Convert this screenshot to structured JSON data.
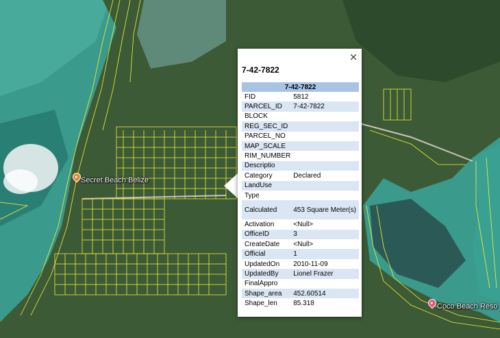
{
  "map": {
    "places": [
      {
        "label": "Secret Beach Belize",
        "pin_color": "#e8843a",
        "icon": "map-pin-icon"
      },
      {
        "label": "Coco Beach Reso",
        "pin_color": "#e05a7a",
        "icon": "map-pin-icon"
      }
    ]
  },
  "popup": {
    "title": "7-42-7822",
    "close_icon": "×",
    "table_header": "7-42-7822",
    "rows": [
      {
        "key": "FID",
        "value": "5812"
      },
      {
        "key": "PARCEL_ID",
        "value": "7-42-7822"
      },
      {
        "key": "BLOCK",
        "value": ""
      },
      {
        "key": "REG_SEC_ID",
        "value": ""
      },
      {
        "key": "PARCEL_NO",
        "value": ""
      },
      {
        "key": "MAP_SCALE",
        "value": ""
      },
      {
        "key": "RIM_NUMBER",
        "value": ""
      },
      {
        "key": "Descriptio",
        "value": ""
      },
      {
        "key": "Category",
        "value": "Declared"
      },
      {
        "key": "LandUse",
        "value": ""
      },
      {
        "key": "Type",
        "value": ""
      },
      {
        "key": "Calculated",
        "value": "453 Square Meter(s)"
      },
      {
        "key": "Activation",
        "value": "<Null>"
      },
      {
        "key": "OfficeID",
        "value": "3"
      },
      {
        "key": "CreateDate",
        "value": "<Null>"
      },
      {
        "key": "Official",
        "value": "1"
      },
      {
        "key": "UpdatedOn",
        "value": "2010-11-09"
      },
      {
        "key": "UpdatedBy",
        "value": "Lionel Frazer"
      },
      {
        "key": "FinalAppro",
        "value": ""
      },
      {
        "key": "Shape_area",
        "value": "452.60514"
      },
      {
        "key": "Shape_len",
        "value": "85.318"
      }
    ]
  }
}
